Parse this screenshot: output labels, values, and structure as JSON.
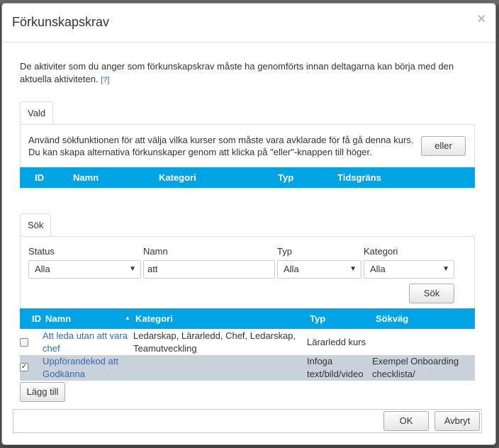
{
  "dialog": {
    "title": "Förkunskapskrav",
    "close_glyph": "×"
  },
  "intro": {
    "text": "De aktiviter som du anger som förkunskapskrav måste ha genomförts innan deltagarna kan börja med den aktuella aktiviteten.",
    "help_link": "[?]"
  },
  "selected": {
    "tab": "Vald",
    "hint_line1": "Använd sökfunktionen för att välja vilka kurser som måste vara avklarade för få gå denna kurs.",
    "hint_line2": "Du kan skapa alternativa förkunskaper genom att klicka på \"eller\"-knappen till höger.",
    "or_button": "eller",
    "columns": [
      "ID",
      "Namn",
      "Kategori",
      "Typ",
      "Tidsgräns"
    ]
  },
  "search": {
    "tab": "Sök",
    "filters": {
      "status_label": "Status",
      "status_value": "Alla",
      "name_label": "Namn",
      "name_value": "att",
      "type_label": "Typ",
      "type_value": "Alla",
      "category_label": "Kategori",
      "category_value": "Alla"
    },
    "search_button": "Sök",
    "columns": [
      "ID",
      "Namn",
      "Kategori",
      "Typ",
      "Sökväg"
    ],
    "sort_indicator": "▲",
    "rows": [
      {
        "checked": false,
        "name_line1": "Att leda utan att vara",
        "name_line2": "chef",
        "category_line1": "Ledarskap, Lärarledd, Chef, Ledarskap,",
        "category_line2": "Teamutveckling",
        "type_line1": "Lärarledd kurs",
        "type_line2": "",
        "path_line1": "",
        "path_line2": ""
      },
      {
        "checked": true,
        "name_line1": "Uppförandekod att",
        "name_line2": "Godkänna",
        "category_line1": "",
        "category_line2": "",
        "type_line1": "Infoga",
        "type_line2": "text/bild/video",
        "path_line1": "Exempel Onboarding",
        "path_line2": "checklista/"
      }
    ],
    "add_button": "Lägg till"
  },
  "footer": {
    "ok_button": "OK",
    "cancel_button": "Avbryt"
  },
  "colors": {
    "grid_header": "#00a4e4",
    "selected_row": "#c9d2da",
    "link": "#2a6cc7"
  }
}
